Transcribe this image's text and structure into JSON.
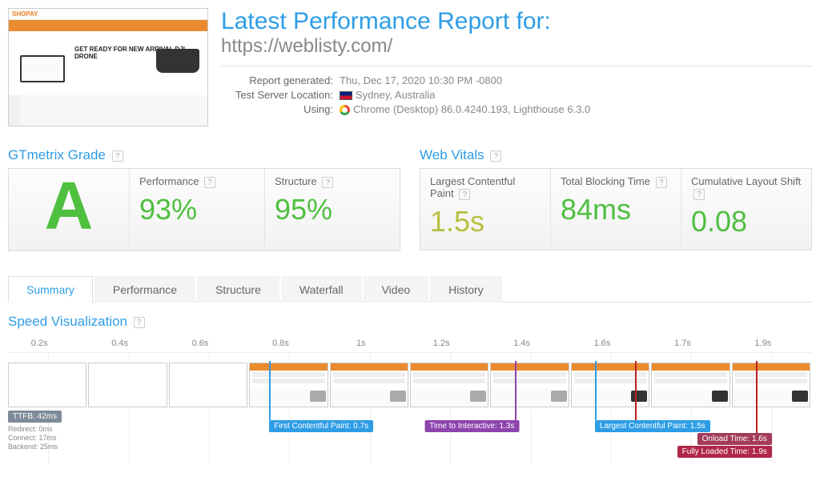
{
  "title": "Latest Performance Report for:",
  "url": "https://weblisty.com/",
  "meta": {
    "generated_label": "Report generated:",
    "generated_value": "Thu, Dec 17, 2020 10:30 PM -0800",
    "location_label": "Test Server Location:",
    "location_value": "Sydney, Australia",
    "using_label": "Using:",
    "using_value": "Chrome (Desktop) 86.0.4240.193, Lighthouse 6.3.0"
  },
  "thumb": {
    "logo": "SHOPAY",
    "hero": "GET READY FOR NEW ARRIVAL DJI DRONE"
  },
  "grade": {
    "section": "GTmetrix Grade",
    "letter": "A",
    "perf_label": "Performance",
    "perf_value": "93%",
    "struct_label": "Structure",
    "struct_value": "95%"
  },
  "vitals": {
    "section": "Web Vitals",
    "lcp_label": "Largest Contentful Paint",
    "lcp_value": "1.5s",
    "tbt_label": "Total Blocking Time",
    "tbt_value": "84ms",
    "cls_label": "Cumulative Layout Shift",
    "cls_value": "0.08"
  },
  "tabs": [
    "Summary",
    "Performance",
    "Structure",
    "Waterfall",
    "Video",
    "History"
  ],
  "speed": {
    "title": "Speed Visualization",
    "ticks": [
      "0.2s",
      "0.4s",
      "0.6s",
      "0.8s",
      "1s",
      "1.2s",
      "1.4s",
      "1.6s",
      "1.7s",
      "1.9s"
    ],
    "ttfb": {
      "label": "TTFB: 42ms",
      "redirect": "Redirect: 0ms",
      "connect": "Connect: 17ms",
      "backend": "Backend: 25ms"
    },
    "markers": {
      "fcp": "First Contentful Paint: 0.7s",
      "tti": "Time to Interactive: 1.3s",
      "lcp": "Largest Contentful Paint: 1.5s",
      "onload": "Onload Time: 1.6s",
      "full": "Fully Loaded Time: 1.9s"
    }
  },
  "help": "?"
}
